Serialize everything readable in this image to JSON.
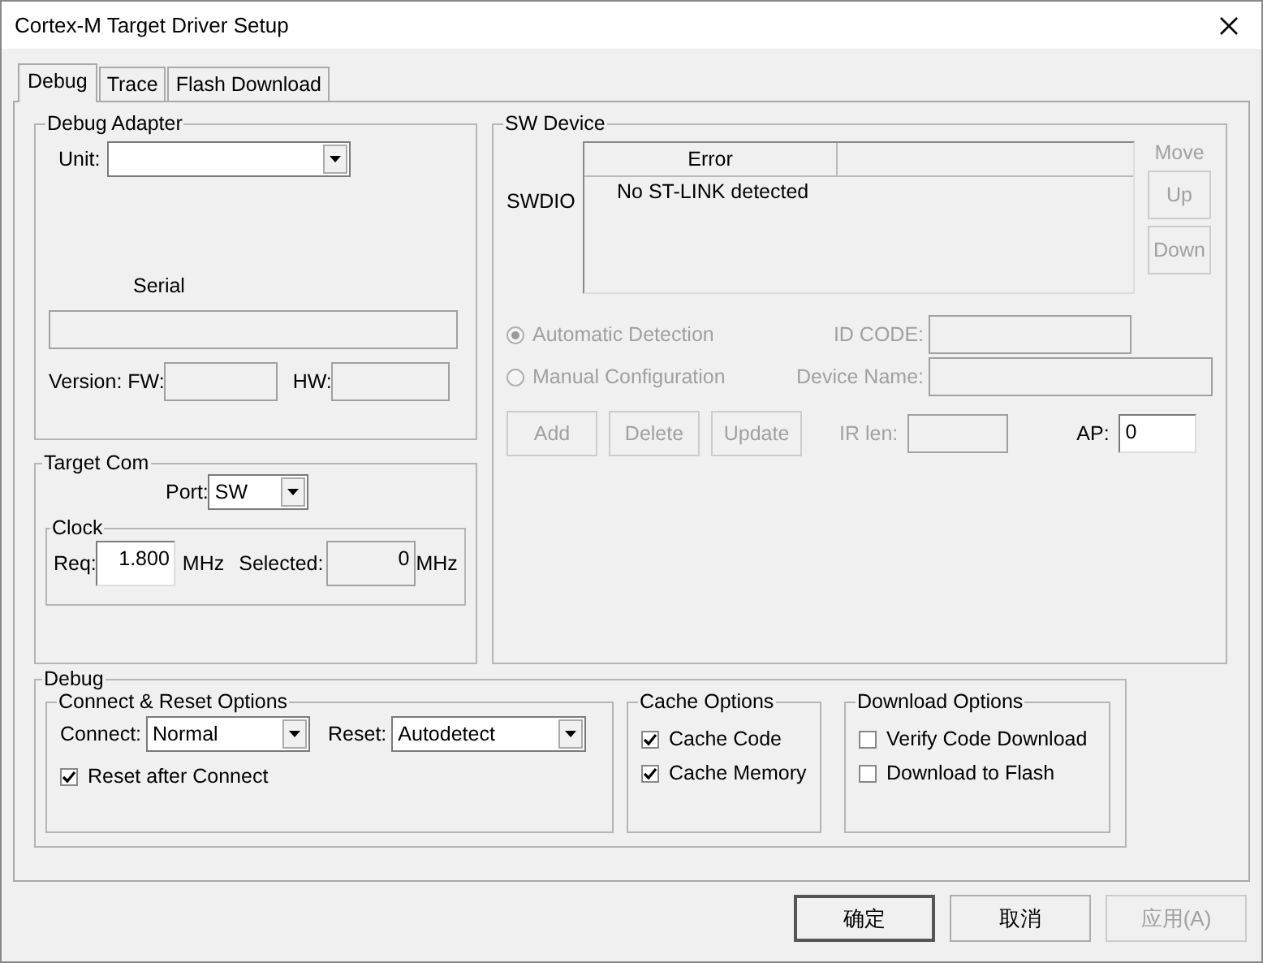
{
  "window": {
    "title": "Cortex-M Target Driver Setup"
  },
  "tabs": [
    {
      "label": "Debug",
      "selected": true
    },
    {
      "label": "Trace",
      "selected": false
    },
    {
      "label": "Flash Download",
      "selected": false
    }
  ],
  "debug_adapter": {
    "title": "Debug Adapter",
    "unit_label": "Unit:",
    "serial_label": "Serial",
    "fw_label": "Version: FW:",
    "hw_label": "HW:"
  },
  "target_com": {
    "title": "Target Com",
    "port_label": "Port:",
    "port_value": "SW",
    "clock": {
      "title": "Clock",
      "req_label": "Req:",
      "req_value": "1.800",
      "req_unit": "MHz",
      "selected_label": "Selected:",
      "selected_value": "0",
      "selected_unit": "MHz"
    }
  },
  "sw_device": {
    "title": "SW Device",
    "row_label": "SWDIO",
    "columns": [
      "Error"
    ],
    "rows": [
      "No ST-LINK detected"
    ],
    "move_label": "Move",
    "move_buttons": [
      {
        "label": "Up",
        "disabled": true
      },
      {
        "label": "Down",
        "disabled": true
      }
    ],
    "detection": [
      {
        "label": "Automatic Detection",
        "selected": true,
        "disabled": true
      },
      {
        "label": "Manual Configuration",
        "selected": false,
        "disabled": true
      }
    ],
    "id_code_label": "ID CODE:",
    "device_name_label": "Device Name:",
    "ir_len_label": "IR len:",
    "ap_label": "AP:",
    "ap_value": "0",
    "buttons": [
      {
        "label": "Add",
        "disabled": true
      },
      {
        "label": "Delete",
        "disabled": true
      },
      {
        "label": "Update",
        "disabled": true
      }
    ]
  },
  "debug": {
    "title": "Debug",
    "connect_reset": {
      "title": "Connect & Reset Options",
      "connect_label": "Connect:",
      "connect_value": "Normal",
      "reset_label": "Reset:",
      "reset_value": "Autodetect",
      "options": [
        {
          "label": "Reset after Connect",
          "checked": true
        }
      ]
    },
    "cache": {
      "title": "Cache Options",
      "options": [
        {
          "label": "Cache Code",
          "checked": true
        },
        {
          "label": "Cache Memory",
          "checked": true
        }
      ]
    },
    "download": {
      "title": "Download Options",
      "options": [
        {
          "label": "Verify Code Download",
          "checked": false
        },
        {
          "label": "Download to Flash",
          "checked": false
        }
      ]
    }
  },
  "buttons": [
    {
      "label": "确定",
      "disabled": false,
      "default": true
    },
    {
      "label": "取消",
      "disabled": false,
      "default": false
    },
    {
      "label": "应用(A)",
      "disabled": true,
      "default": false
    }
  ]
}
